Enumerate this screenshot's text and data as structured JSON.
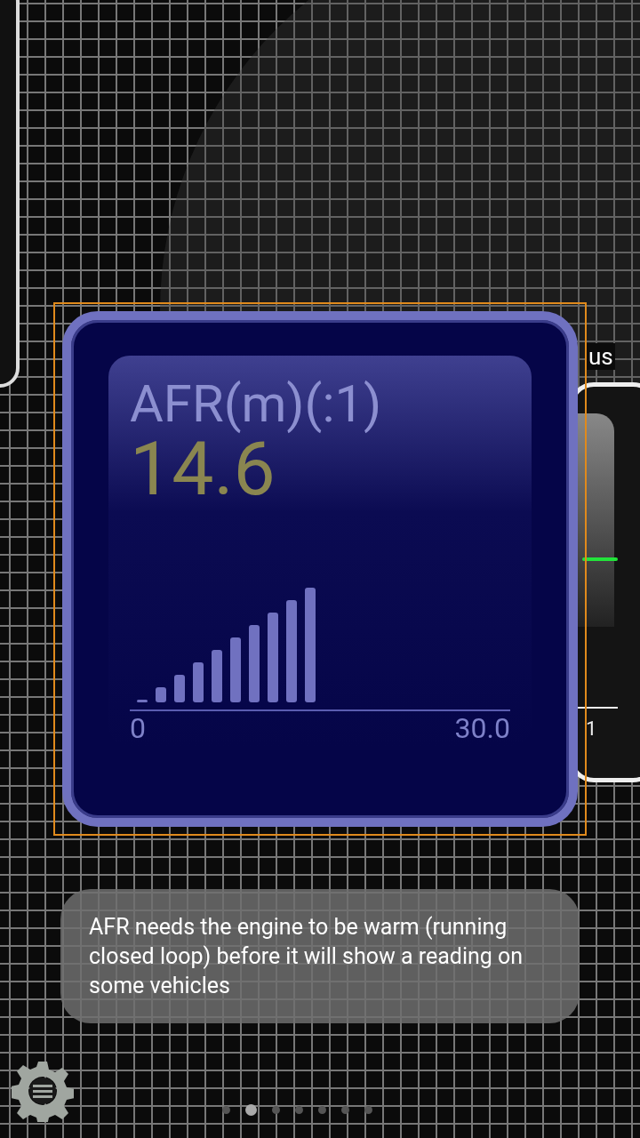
{
  "gauge": {
    "selected": true,
    "label": "AFR(m)(:1)",
    "value": "14.6",
    "level": 0.487,
    "scale_min": "0",
    "scale_max": "30.0"
  },
  "right_gauge": {
    "title": "us",
    "scale_label": "1"
  },
  "toast": {
    "message": "AFR needs the engine to be warm (running closed loop) before it will show a reading on some vehicles"
  },
  "pages": [
    {
      "selected": false
    },
    {
      "selected": true
    },
    {
      "selected": false
    },
    {
      "selected": false
    },
    {
      "selected": false
    },
    {
      "selected": false
    },
    {
      "selected": false
    }
  ]
}
